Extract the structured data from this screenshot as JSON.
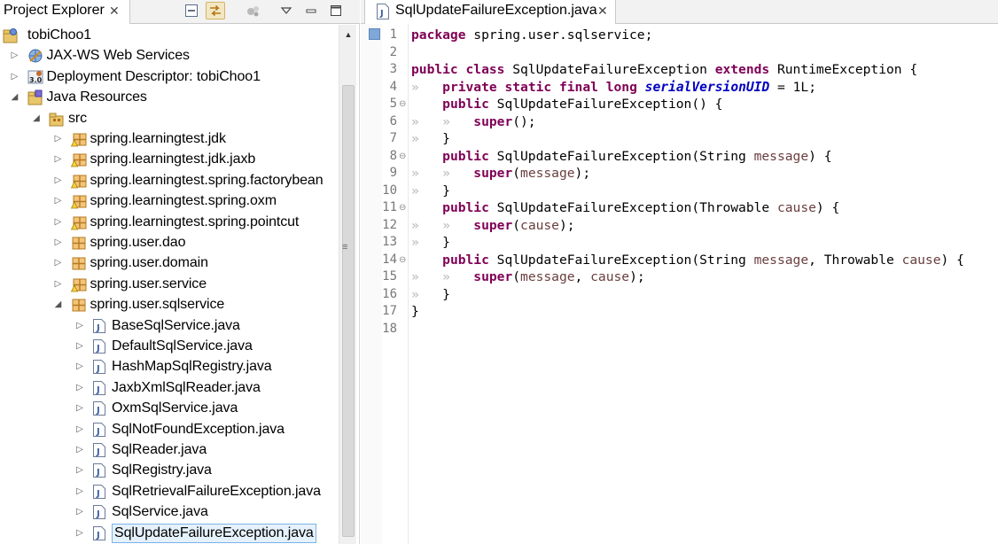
{
  "project_explorer": {
    "tab_title": "Project Explorer",
    "close_glyph": "✕",
    "toolbar": [
      "collapse-all-icon",
      "link-with-editor-icon",
      "filters-icon",
      "view-menu-icon",
      "minimize-icon",
      "maximize-icon"
    ],
    "tree": [
      {
        "label": "tobiChoo1",
        "icon": "project-icon",
        "arrow": "",
        "depth": 0
      },
      {
        "label": "JAX-WS Web Services",
        "icon": "web-services-icon",
        "arrow": "▷",
        "depth": 1
      },
      {
        "label": "Deployment Descriptor: tobiChoo1",
        "icon": "deployment-descriptor-icon",
        "arrow": "▷",
        "depth": 1
      },
      {
        "label": "Java Resources",
        "icon": "java-resources-icon",
        "arrow": "◢",
        "depth": 1
      },
      {
        "label": "src",
        "icon": "source-folder-icon",
        "arrow": "◢",
        "depth": 2
      },
      {
        "label": "spring.learningtest.jdk",
        "icon": "package-warning-icon",
        "arrow": "▷",
        "depth": 3
      },
      {
        "label": "spring.learningtest.jdk.jaxb",
        "icon": "package-warning-icon",
        "arrow": "▷",
        "depth": 3
      },
      {
        "label": "spring.learningtest.spring.factorybean",
        "icon": "package-warning-icon",
        "arrow": "▷",
        "depth": 3
      },
      {
        "label": "spring.learningtest.spring.oxm",
        "icon": "package-warning-icon",
        "arrow": "▷",
        "depth": 3
      },
      {
        "label": "spring.learningtest.spring.pointcut",
        "icon": "package-warning-icon",
        "arrow": "▷",
        "depth": 3
      },
      {
        "label": "spring.user.dao",
        "icon": "package-icon",
        "arrow": "▷",
        "depth": 3
      },
      {
        "label": "spring.user.domain",
        "icon": "package-icon",
        "arrow": "▷",
        "depth": 3
      },
      {
        "label": "spring.user.service",
        "icon": "package-warning-icon",
        "arrow": "▷",
        "depth": 3
      },
      {
        "label": "spring.user.sqlservice",
        "icon": "package-icon",
        "arrow": "◢",
        "depth": 3
      },
      {
        "label": "BaseSqlService.java",
        "icon": "java-file-icon",
        "arrow": "▷",
        "depth": 4
      },
      {
        "label": "DefaultSqlService.java",
        "icon": "java-file-icon",
        "arrow": "▷",
        "depth": 4
      },
      {
        "label": "HashMapSqlRegistry.java",
        "icon": "java-file-icon",
        "arrow": "▷",
        "depth": 4
      },
      {
        "label": "JaxbXmlSqlReader.java",
        "icon": "java-file-icon",
        "arrow": "▷",
        "depth": 4
      },
      {
        "label": "OxmSqlService.java",
        "icon": "java-file-icon",
        "arrow": "▷",
        "depth": 4
      },
      {
        "label": "SqlNotFoundException.java",
        "icon": "java-file-icon",
        "arrow": "▷",
        "depth": 4
      },
      {
        "label": "SqlReader.java",
        "icon": "java-file-icon",
        "arrow": "▷",
        "depth": 4
      },
      {
        "label": "SqlRegistry.java",
        "icon": "java-file-icon",
        "arrow": "▷",
        "depth": 4
      },
      {
        "label": "SqlRetrievalFailureException.java",
        "icon": "java-file-icon",
        "arrow": "▷",
        "depth": 4
      },
      {
        "label": "SqlService.java",
        "icon": "java-file-icon",
        "arrow": "▷",
        "depth": 4
      },
      {
        "label": "SqlUpdateFailureException.java",
        "icon": "java-file-icon",
        "arrow": "▷",
        "depth": 4,
        "selected": true
      }
    ]
  },
  "editor": {
    "tab_title": "SqlUpdateFailureException.java",
    "close_glyph": "✕",
    "lines": [
      {
        "num": "1",
        "fold": "",
        "tokens": [
          {
            "t": "package",
            "c": "kw"
          },
          {
            "t": " spring.user.sqlservice;",
            "c": ""
          }
        ]
      },
      {
        "num": "2",
        "fold": "",
        "tokens": []
      },
      {
        "num": "3",
        "fold": "",
        "tokens": [
          {
            "t": "public",
            "c": "kw"
          },
          {
            "t": " ",
            "c": ""
          },
          {
            "t": "class",
            "c": "kw"
          },
          {
            "t": " SqlUpdateFailureException ",
            "c": ""
          },
          {
            "t": "extends",
            "c": "kw"
          },
          {
            "t": " RuntimeException {",
            "c": ""
          }
        ]
      },
      {
        "num": "4",
        "fold": "",
        "tokens": [
          {
            "t": "»   ",
            "c": "ws"
          },
          {
            "t": "private",
            "c": "kw"
          },
          {
            "t": " ",
            "c": ""
          },
          {
            "t": "static",
            "c": "kw"
          },
          {
            "t": " ",
            "c": ""
          },
          {
            "t": "final",
            "c": "kw"
          },
          {
            "t": " ",
            "c": ""
          },
          {
            "t": "long",
            "c": "kw"
          },
          {
            "t": " ",
            "c": ""
          },
          {
            "t": "serialVersionUID",
            "c": "fld"
          },
          {
            "t": " = 1L;",
            "c": ""
          }
        ]
      },
      {
        "num": "5",
        "fold": "⊖",
        "tokens": [
          {
            "t": "    ",
            "c": ""
          },
          {
            "t": "public",
            "c": "kw"
          },
          {
            "t": " SqlUpdateFailureException() {",
            "c": ""
          }
        ]
      },
      {
        "num": "6",
        "fold": "",
        "tokens": [
          {
            "t": "»   »   ",
            "c": "ws"
          },
          {
            "t": "super",
            "c": "kw"
          },
          {
            "t": "();",
            "c": ""
          }
        ]
      },
      {
        "num": "7",
        "fold": "",
        "tokens": [
          {
            "t": "»   ",
            "c": "ws"
          },
          {
            "t": "}",
            "c": ""
          }
        ]
      },
      {
        "num": "8",
        "fold": "⊖",
        "tokens": [
          {
            "t": "    ",
            "c": ""
          },
          {
            "t": "public",
            "c": "kw"
          },
          {
            "t": " SqlUpdateFailureException(String ",
            "c": ""
          },
          {
            "t": "message",
            "c": "param"
          },
          {
            "t": ") {",
            "c": ""
          }
        ]
      },
      {
        "num": "9",
        "fold": "",
        "tokens": [
          {
            "t": "»   »   ",
            "c": "ws"
          },
          {
            "t": "super",
            "c": "kw"
          },
          {
            "t": "(",
            "c": ""
          },
          {
            "t": "message",
            "c": "param"
          },
          {
            "t": ");",
            "c": ""
          }
        ]
      },
      {
        "num": "10",
        "fold": "",
        "tokens": [
          {
            "t": "»   ",
            "c": "ws"
          },
          {
            "t": "}",
            "c": ""
          }
        ]
      },
      {
        "num": "11",
        "fold": "⊖",
        "tokens": [
          {
            "t": "    ",
            "c": ""
          },
          {
            "t": "public",
            "c": "kw"
          },
          {
            "t": " SqlUpdateFailureException(Throwable ",
            "c": ""
          },
          {
            "t": "cause",
            "c": "param"
          },
          {
            "t": ") {",
            "c": ""
          }
        ]
      },
      {
        "num": "12",
        "fold": "",
        "tokens": [
          {
            "t": "»   »   ",
            "c": "ws"
          },
          {
            "t": "super",
            "c": "kw"
          },
          {
            "t": "(",
            "c": ""
          },
          {
            "t": "cause",
            "c": "param"
          },
          {
            "t": ");",
            "c": ""
          }
        ]
      },
      {
        "num": "13",
        "fold": "",
        "tokens": [
          {
            "t": "»   ",
            "c": "ws"
          },
          {
            "t": "}",
            "c": ""
          }
        ]
      },
      {
        "num": "14",
        "fold": "⊖",
        "tokens": [
          {
            "t": "    ",
            "c": ""
          },
          {
            "t": "public",
            "c": "kw"
          },
          {
            "t": " SqlUpdateFailureException(String ",
            "c": ""
          },
          {
            "t": "message",
            "c": "param"
          },
          {
            "t": ", Throwable ",
            "c": ""
          },
          {
            "t": "cause",
            "c": "param"
          },
          {
            "t": ") {",
            "c": ""
          }
        ]
      },
      {
        "num": "15",
        "fold": "",
        "tokens": [
          {
            "t": "»   »   ",
            "c": "ws"
          },
          {
            "t": "super",
            "c": "kw"
          },
          {
            "t": "(",
            "c": ""
          },
          {
            "t": "message",
            "c": "param"
          },
          {
            "t": ", ",
            "c": ""
          },
          {
            "t": "cause",
            "c": "param"
          },
          {
            "t": ");",
            "c": ""
          }
        ]
      },
      {
        "num": "16",
        "fold": "",
        "tokens": [
          {
            "t": "»   ",
            "c": "ws"
          },
          {
            "t": "}",
            "c": ""
          }
        ]
      },
      {
        "num": "17",
        "fold": "",
        "tokens": [
          {
            "t": "}",
            "c": ""
          }
        ]
      },
      {
        "num": "18",
        "fold": "",
        "tokens": []
      }
    ]
  },
  "colors": {
    "keyword": "#7f0055",
    "field": "#0000c0",
    "parameter": "#6a3e3e",
    "selection": "#e5f1fb"
  }
}
